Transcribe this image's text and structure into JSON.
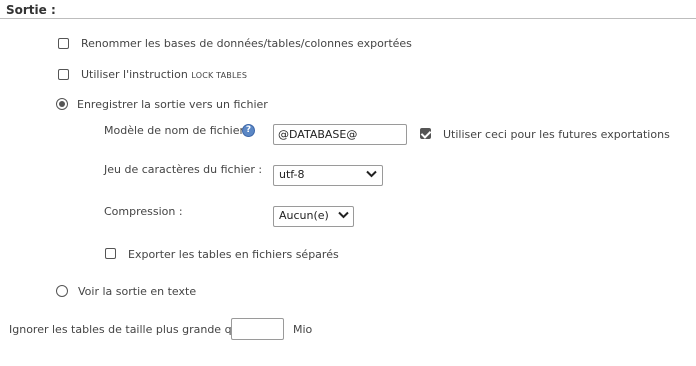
{
  "section": {
    "title": "Sortie :"
  },
  "options": {
    "rename_label": "Renommer les bases de données/tables/colonnes exportées",
    "lock_prefix": "Utiliser l'instruction",
    "lock_code": "LOCK TABLES",
    "save_to_file_label": "Enregistrer la sortie vers un fichier",
    "view_as_text_label": "Voir la sortie en texte"
  },
  "file": {
    "template_label": "Modèle de nom de fichier :",
    "template_value": "@DATABASE@",
    "remember_label": "Utiliser ceci pour les futures exportations",
    "charset_label": "Jeu de caractères du fichier :",
    "charset_value": "utf-8",
    "compression_label": "Compression :",
    "compression_value": "Aucun(e)",
    "separate_files_label": "Exporter les tables en fichiers séparés"
  },
  "state": {
    "rename_checked": false,
    "lock_checked": false,
    "output_mode": "file",
    "remember_checked": true,
    "separate_files_checked": false
  },
  "size_limit": {
    "label": "Ignorer les tables de taille plus grande que",
    "value": "",
    "unit": "Mio"
  },
  "icons": {
    "info": "info-icon",
    "select_arrow": "chevron-down-icon"
  },
  "colors": {
    "info_icon": "#5b87c5",
    "control": "#555555"
  }
}
